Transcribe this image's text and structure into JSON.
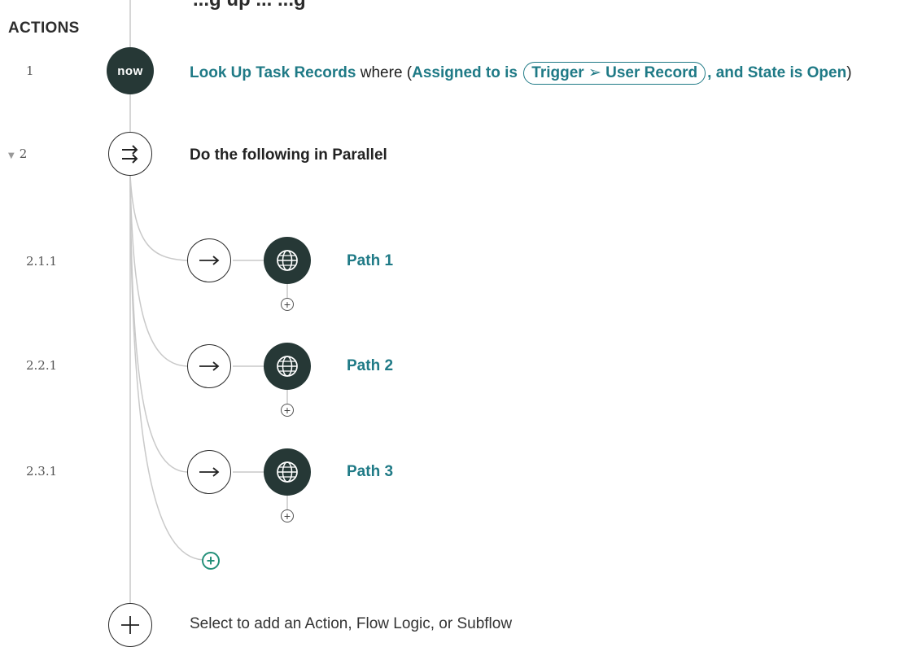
{
  "page": {
    "cut_title": "...g up ... ...g"
  },
  "actions_heading": "ACTIONS",
  "steps": [
    {
      "number": "1",
      "icon": "servicenow-now-icon",
      "icon_text": "now",
      "action": "Look Up Task Records",
      "where_text": "where (",
      "condition_part1": "Assigned to is",
      "pill": "Trigger ➢ User Record",
      "condition_part2": ", and State is Open",
      "close_paren": ")"
    },
    {
      "number": "2",
      "icon": "parallel-arrows-icon",
      "label": "Do the following in Parallel",
      "expand_icon": "triangle-down-icon"
    }
  ],
  "paths": [
    {
      "number": "2.1.1",
      "icon": "globe-icon",
      "label": "Path 1"
    },
    {
      "number": "2.2.1",
      "icon": "globe-icon",
      "label": "Path 2"
    },
    {
      "number": "2.3.1",
      "icon": "globe-icon",
      "label": "Path 3"
    }
  ],
  "add_step_label": "Select to add an Action, Flow Logic, or Subflow",
  "colors": {
    "accent_teal": "#1f7a86",
    "add_green": "#24907a",
    "icon_dark": "#263836",
    "line_gray": "#c7c7c7"
  }
}
